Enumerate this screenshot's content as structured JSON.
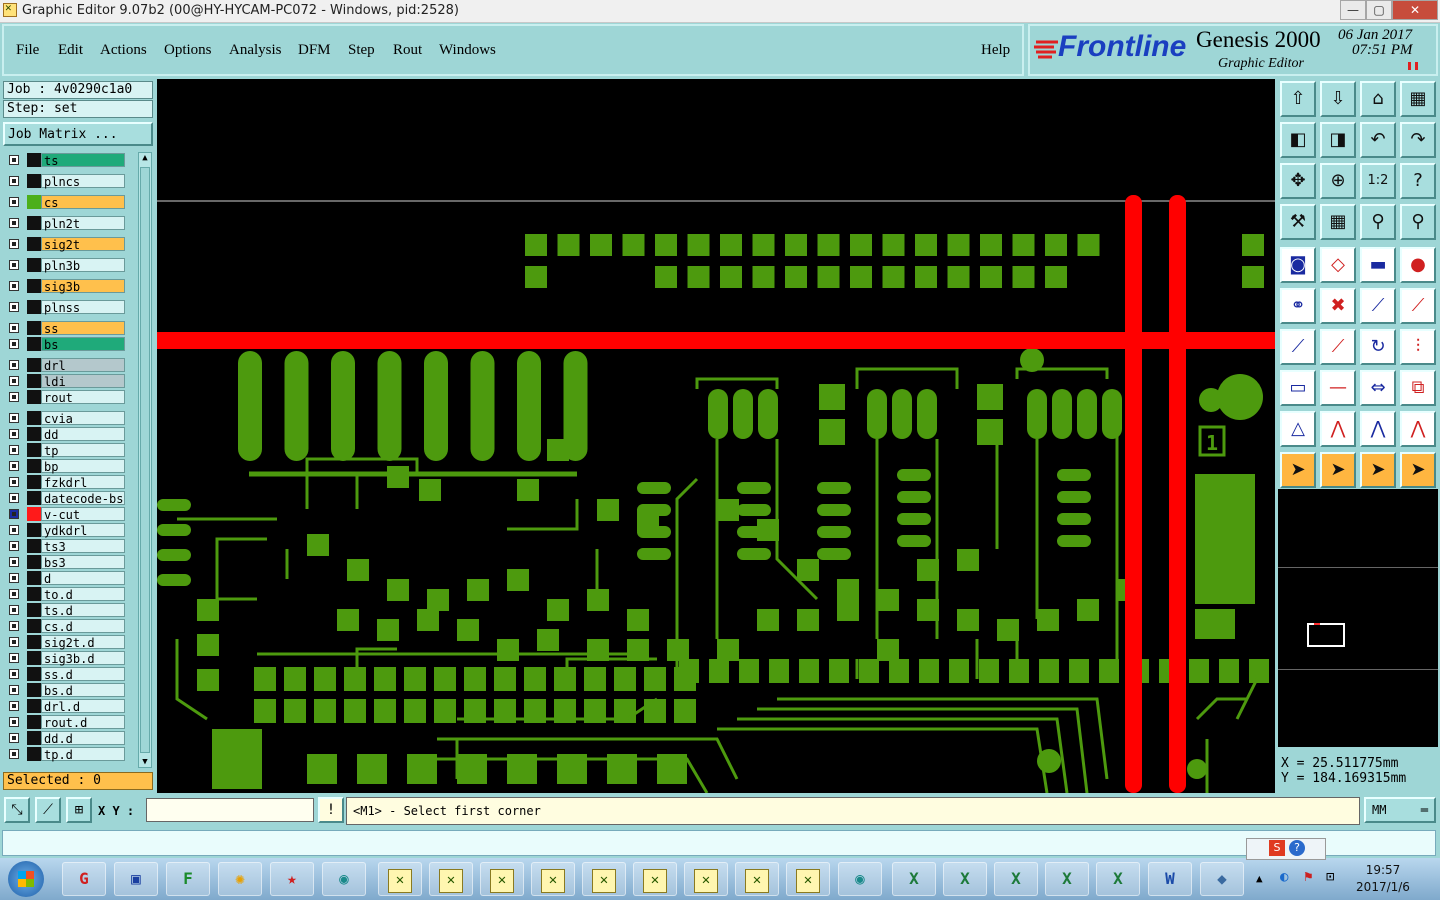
{
  "window": {
    "title": "Graphic Editor 9.07b2 (00@HY-HYCAM-PC072 - Windows, pid:2528)",
    "controls": [
      "—",
      "▢",
      "✕"
    ]
  },
  "menu": {
    "items": [
      "File",
      "Edit",
      "Actions",
      "Options",
      "Analysis",
      "DFM",
      "Step",
      "Rout",
      "Windows"
    ],
    "help": "Help"
  },
  "brand": {
    "logo": "Frontline",
    "product": "Genesis 2000",
    "module": "Graphic Editor",
    "date": "06 Jan 2017",
    "time": "07:51 PM"
  },
  "job": {
    "job_label": "Job : 4v0290c1a0",
    "step_label": "Step: set",
    "matrix_button": "Job Matrix ..."
  },
  "layers": [
    {
      "name": "ts",
      "color": "#1faa7a",
      "swatch": "#111"
    },
    {
      "name": "plncs",
      "color": "#d8f3f3",
      "swatch": "#111"
    },
    {
      "name": "cs",
      "color": "#ffc04c",
      "swatch": "#4caf1a"
    },
    {
      "name": "pln2t",
      "color": "#d8f3f3",
      "swatch": "#111"
    },
    {
      "name": "sig2t",
      "color": "#ffc04c",
      "swatch": "#111"
    },
    {
      "name": "pln3b",
      "color": "#d8f3f3",
      "swatch": "#111"
    },
    {
      "name": "sig3b",
      "color": "#ffc04c",
      "swatch": "#111"
    },
    {
      "name": "plnss",
      "color": "#d8f3f3",
      "swatch": "#111"
    },
    {
      "name": "ss",
      "color": "#ffc04c",
      "swatch": "#111"
    },
    {
      "name": "bs",
      "color": "#1faa7a",
      "swatch": "#111"
    },
    {
      "name": "drl",
      "color": "#b4c8cc",
      "swatch": "#111"
    },
    {
      "name": "ldi",
      "color": "#b4c8cc",
      "swatch": "#111"
    },
    {
      "name": "rout",
      "color": "#d8f3f3",
      "swatch": "#111"
    },
    {
      "name": "cvia",
      "color": "#d8f3f3",
      "swatch": "#111"
    },
    {
      "name": "dd",
      "color": "#d8f3f3",
      "swatch": "#111"
    },
    {
      "name": "tp",
      "color": "#d8f3f3",
      "swatch": "#111"
    },
    {
      "name": "bp",
      "color": "#d8f3f3",
      "swatch": "#111"
    },
    {
      "name": "fzkdrl",
      "color": "#d8f3f3",
      "swatch": "#111"
    },
    {
      "name": "datecode-bs",
      "color": "#d8f3f3",
      "swatch": "#111"
    },
    {
      "name": "v-cut",
      "color": "#d8f3f3",
      "swatch": "#ff1a1a",
      "active": true
    },
    {
      "name": "ydkdrl",
      "color": "#d8f3f3",
      "swatch": "#111"
    },
    {
      "name": "ts3",
      "color": "#d8f3f3",
      "swatch": "#111"
    },
    {
      "name": "bs3",
      "color": "#d8f3f3",
      "swatch": "#111"
    },
    {
      "name": "d",
      "color": "#d8f3f3",
      "swatch": "#111"
    },
    {
      "name": "to.d",
      "color": "#d8f3f3",
      "swatch": "#111"
    },
    {
      "name": "ts.d",
      "color": "#d8f3f3",
      "swatch": "#111"
    },
    {
      "name": "cs.d",
      "color": "#d8f3f3",
      "swatch": "#111"
    },
    {
      "name": "sig2t.d",
      "color": "#d8f3f3",
      "swatch": "#111"
    },
    {
      "name": "sig3b.d",
      "color": "#d8f3f3",
      "swatch": "#111"
    },
    {
      "name": "ss.d",
      "color": "#d8f3f3",
      "swatch": "#111"
    },
    {
      "name": "bs.d",
      "color": "#d8f3f3",
      "swatch": "#111"
    },
    {
      "name": "drl.d",
      "color": "#d8f3f3",
      "swatch": "#111"
    },
    {
      "name": "rout.d",
      "color": "#d8f3f3",
      "swatch": "#111"
    },
    {
      "name": "dd.d",
      "color": "#d8f3f3",
      "swatch": "#111"
    },
    {
      "name": "tp.d",
      "color": "#d8f3f3",
      "swatch": "#111"
    }
  ],
  "selected": "Selected : 0",
  "canvas": {
    "trace_color": "#4d9a0e",
    "vcut_color": "#ff0000",
    "pad_label": "1"
  },
  "toolbar": {
    "icons": [
      "window-up-icon",
      "window-down-icon",
      "home-icon",
      "view-panel-icon",
      "pan-left-icon",
      "pan-right-icon",
      "undo-view-icon",
      "redo-view-icon",
      "zoom-fit-icon",
      "zoom-center-icon",
      "scale-1-2-icon",
      "help-query-icon",
      "tools-icon",
      "grid-icon",
      "snap-icon",
      "snap-layer-icon",
      "fill-pad-icon",
      "shape-edit-icon",
      "ruler-icon",
      "dot-icon",
      "connect-icon",
      "cross-icon",
      "line-point-icon",
      "line-point2-icon",
      "draw-line-icon",
      "measure-icon",
      "rotate-icon",
      "text-icon",
      "move-icon",
      "delete-icon",
      "resize-icon",
      "copy-icon",
      "triangle-icon",
      "arch-icon",
      "arch-up-icon",
      "arch-down-icon",
      "select-arrow-icon",
      "select-box-icon",
      "select-circle-icon",
      "select-route-icon"
    ]
  },
  "coords": {
    "x": "X = 25.511775mm",
    "y": "Y = 184.169315mm"
  },
  "bottom": {
    "xy_label": "X Y :",
    "xy_value": "",
    "prompt": "<M1> - Select first corner",
    "units": "MM"
  },
  "taskbar": {
    "time": "19:57",
    "date": "2017/1/6"
  }
}
